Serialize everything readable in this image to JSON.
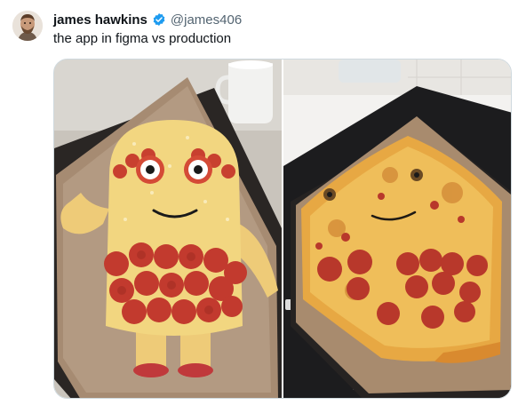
{
  "tweet": {
    "author_name": "james hawkins",
    "handle": "@james406",
    "text": "the app in figma vs production",
    "verified": true,
    "colors": {
      "verified_badge": "#1d9bf0",
      "handle": "#536471",
      "text": "#0f1419"
    }
  },
  "media": {
    "photos": [
      {
        "alt": "figma-photo"
      },
      {
        "alt": "production-photo"
      }
    ]
  },
  "icons": [
    "avatar",
    "verified-badge-icon"
  ]
}
